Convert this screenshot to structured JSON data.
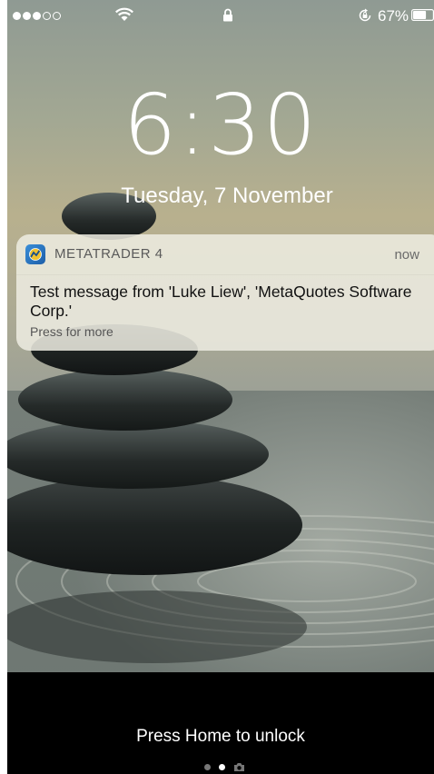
{
  "status_bar": {
    "signal_full_dots": 3,
    "signal_empty_dots": 2,
    "wifi_icon": "wifi-icon",
    "lock_icon": "padlock-icon",
    "orientation_icon": "orientation-lock-icon",
    "battery_percent": "67%",
    "battery_level": 0.67
  },
  "lock_screen": {
    "time": "6:30",
    "date": "Tuesday, 7 November"
  },
  "notification": {
    "app_icon": "metatrader-app-icon",
    "app_name": "METATRADER 4",
    "time": "now",
    "message": "Test message from 'Luke Liew', 'MetaQuotes Software Corp.'",
    "action_hint": "Press for more"
  },
  "bottom": {
    "unlock_text": "Press Home to unlock",
    "page_count": 3,
    "active_page": 1,
    "camera_icon": "camera-icon"
  },
  "colors": {
    "text": "#ffffff",
    "notification_bg": "#eeece2",
    "bottom_bg": "#000000"
  }
}
